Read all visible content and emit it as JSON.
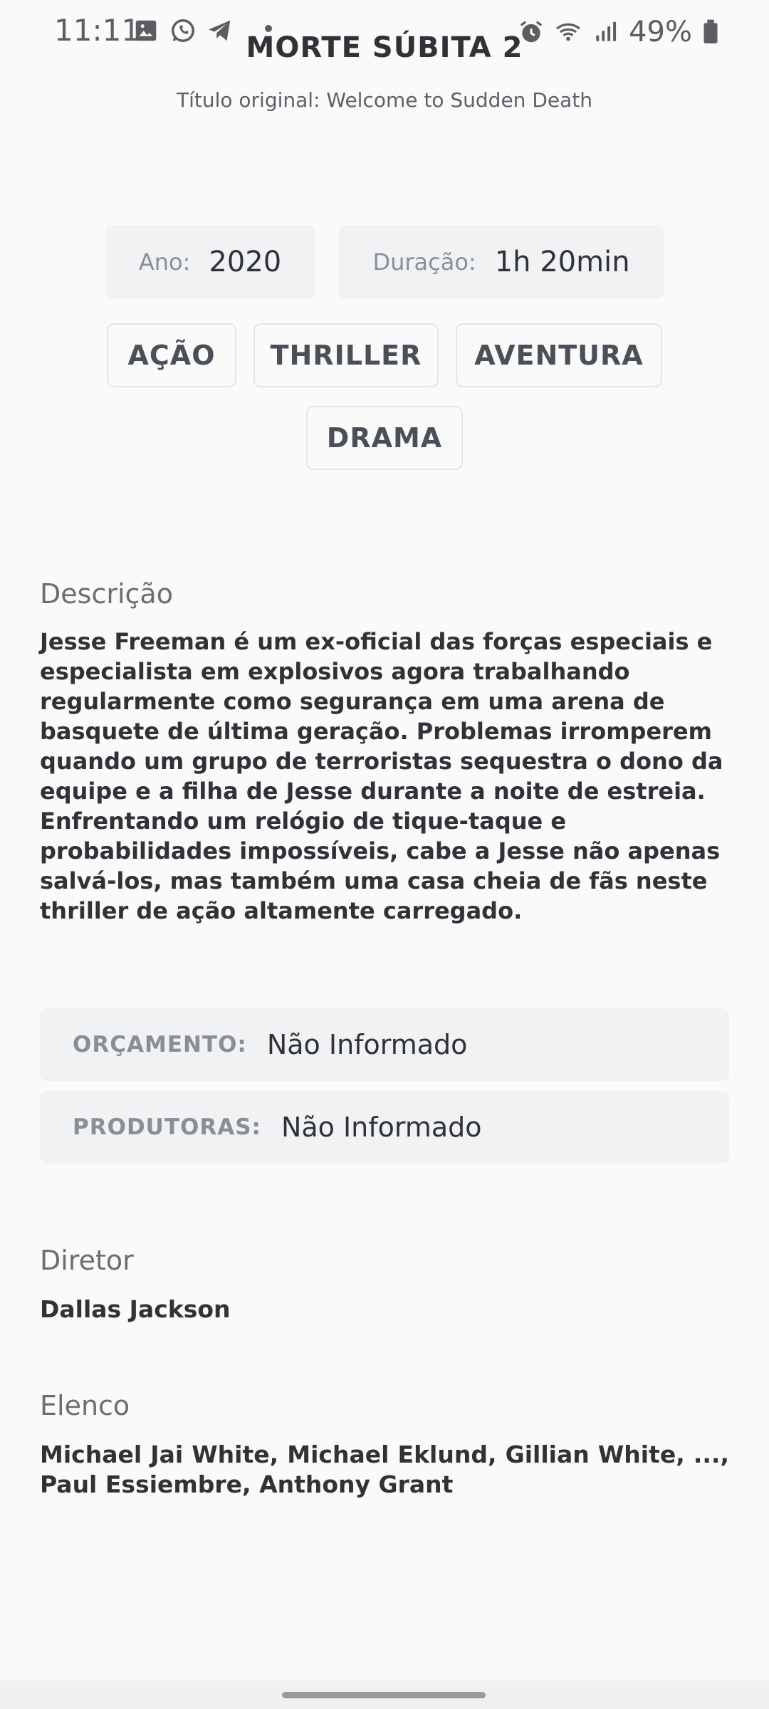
{
  "status_bar": {
    "time": "11:11",
    "battery": "49%",
    "icons_left": [
      "gallery-icon",
      "whatsapp-icon",
      "telegram-icon",
      "dot-icon"
    ],
    "icons_right": [
      "alarm-icon",
      "wifi-icon",
      "signal-icon",
      "battery-icon"
    ]
  },
  "movie": {
    "title": "MORTE SÚBITA 2",
    "original_title": "Título original: Welcome to Sudden Death",
    "year_label": "Ano:",
    "year": "2020",
    "duration_label": "Duração:",
    "duration": "1h 20min",
    "genres": [
      "AÇÃO",
      "THRILLER",
      "AVENTURA",
      "DRAMA"
    ]
  },
  "description": {
    "heading": "Descrição",
    "text": "Jesse Freeman é um ex-oficial das forças especiais e especialista em explosivos agora trabalhando regularmente como segurança em uma arena de basquete de última geração. Problemas irromperem quando um grupo de terroristas sequestra o dono da equipe e a filha de Jesse durante a noite de estreia. Enfrentando um relógio de tique-taque e probabilidades impossíveis, cabe a Jesse não apenas salvá-los, mas também uma casa cheia de fãs neste thriller de ação altamente carregado."
  },
  "info": {
    "budget_label": "ORÇAMENTO:",
    "budget_value": "Não Informado",
    "producers_label": "PRODUTORAS:",
    "producers_value": "Não Informado"
  },
  "director": {
    "heading": "Diretor",
    "name": "Dallas Jackson"
  },
  "cast": {
    "heading": "Elenco",
    "names": "Michael Jai White, Michael Eklund, Gillian White, ..., Paul Essiembre, Anthony Grant"
  }
}
